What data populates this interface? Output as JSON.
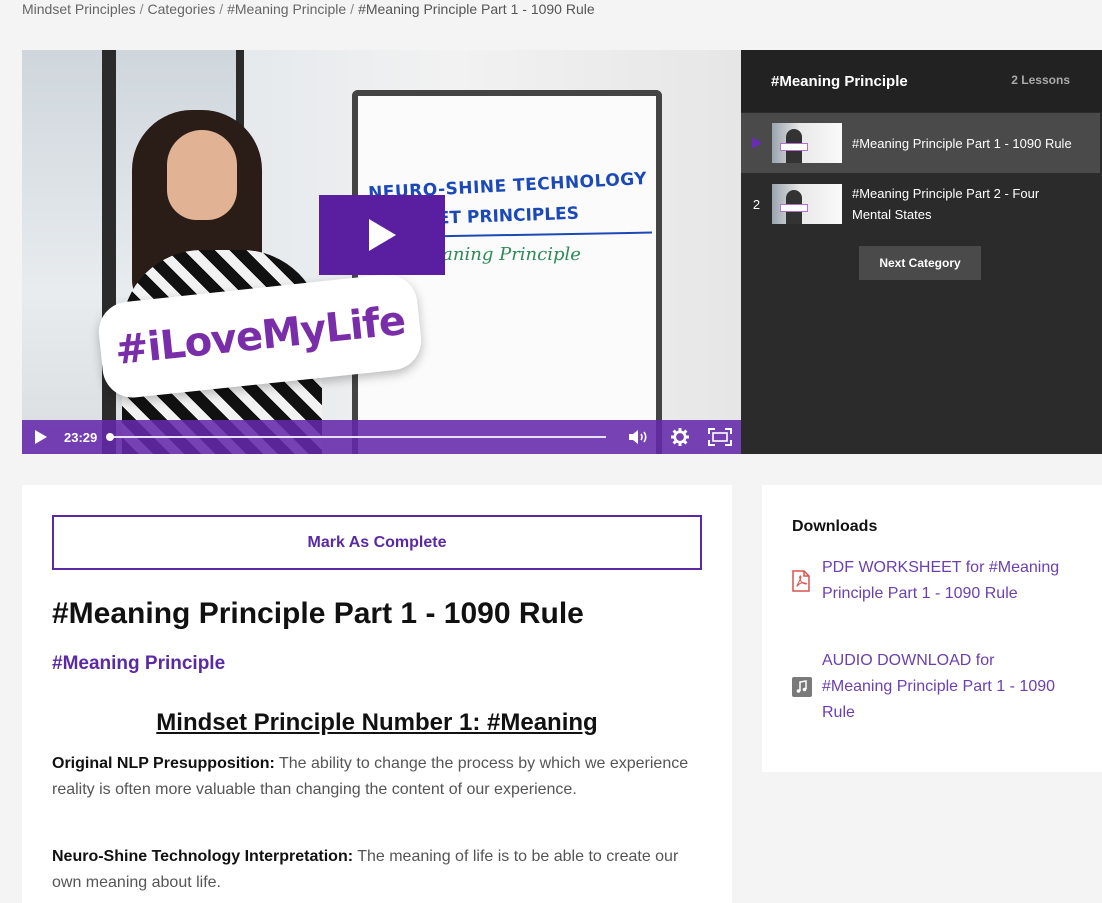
{
  "breadcrumb": {
    "items": [
      "Mindset Principles",
      "Categories",
      "#Meaning Principle"
    ],
    "separator": "/",
    "current": "#Meaning Principle Part 1 - 1090 Rule"
  },
  "video": {
    "board_line1": "NEURO-SHINE TECHNOLOGY",
    "board_line2": "MINDSET PRINCIPLES",
    "board_line3": "#Meaning Principle",
    "sign_text": "#iLoveMyLife",
    "time": "23:29",
    "progress": 0.0,
    "accent": "#5a1fa0"
  },
  "playlist": {
    "title": "#Meaning Principle",
    "count": "2 Lessons",
    "lessons": [
      {
        "index": "",
        "label": "#Meaning Principle Part 1 - 1090 Rule",
        "active": true
      },
      {
        "index": "2",
        "label": "#Meaning Principle Part 2 - Four Mental States",
        "active": false
      }
    ],
    "next_label": "Next Category"
  },
  "content": {
    "mark_complete": "Mark As Complete",
    "title": "#Meaning Principle Part 1 - 1090 Rule",
    "category": "#Meaning Principle",
    "section_heading": "Mindset Principle Number 1: #Meaning",
    "p1_label": "Original NLP Presupposition:",
    "p1_text": " The ability to change the process by which we experience reality is often more valuable than changing the content of our experience.",
    "p2_label": "Neuro-Shine Technology Interpretation:",
    "p2_text": " The meaning of life is to be able to create our own meaning about life."
  },
  "downloads": {
    "title": "Downloads",
    "items": [
      {
        "icon": "pdf-icon",
        "label": "PDF WORKSHEET for #Meaning Principle Part 1 - 1090 Rule"
      },
      {
        "icon": "audio-file-icon",
        "label": "AUDIO DOWNLOAD for #Meaning Principle Part 1 - 1090 Rule"
      }
    ]
  }
}
